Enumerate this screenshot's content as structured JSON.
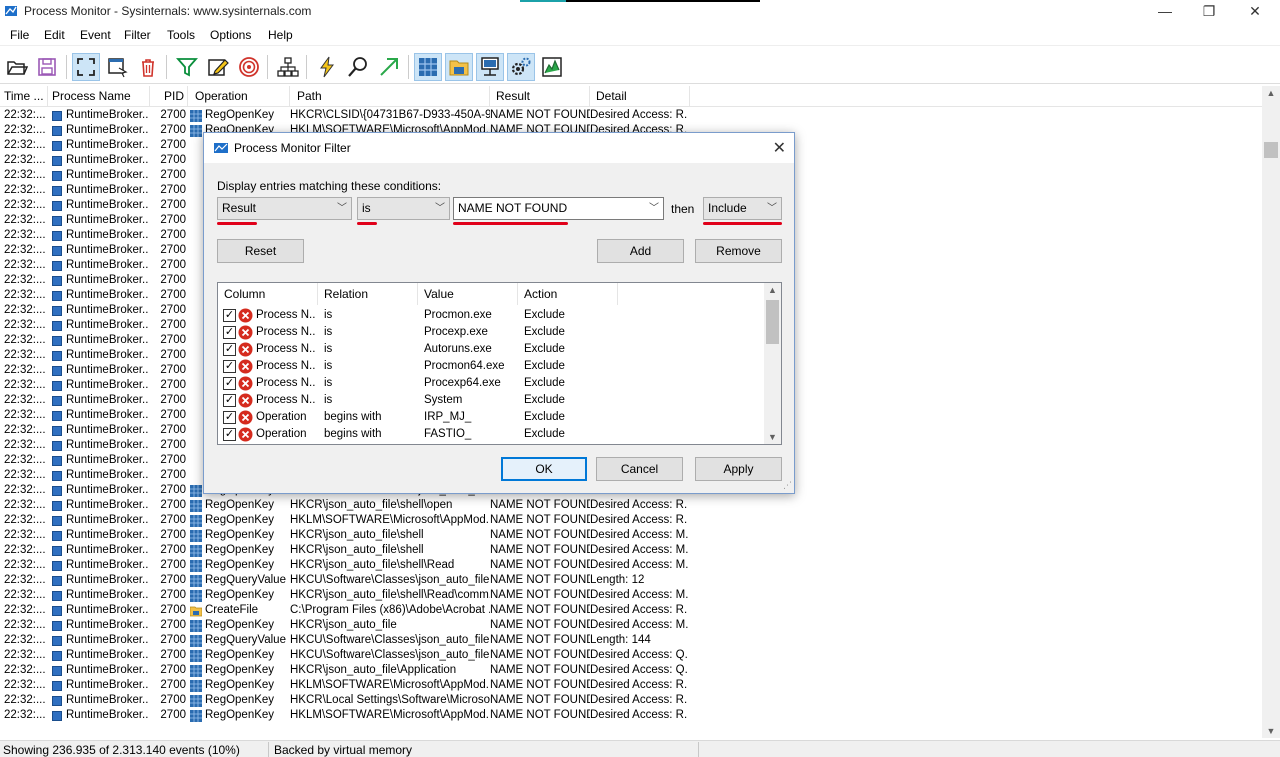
{
  "window": {
    "title": "Process Monitor - Sysinternals: www.sysinternals.com",
    "minimize_label": "—",
    "maximize_label": "❐",
    "close_label": "✕"
  },
  "menu": [
    "File",
    "Edit",
    "Event",
    "Filter",
    "Tools",
    "Options",
    "Help"
  ],
  "toolbar": {
    "icons": [
      "open-icon",
      "save-icon",
      "capture-icon",
      "autoscroll-icon",
      "clear-icon",
      "filter-icon",
      "highlight-icon",
      "target-icon",
      "process-tree-icon",
      "event-properties-icon",
      "find-icon",
      "jump-to-icon",
      "registry-activity-icon",
      "filesystem-activity-icon",
      "network-activity-icon",
      "process-activity-icon",
      "profiling-activity-icon"
    ]
  },
  "columns": [
    "Time ...",
    "Process Name",
    "PID",
    "Operation",
    "Path",
    "Result",
    "Detail"
  ],
  "events": [
    {
      "time": "22:32:...",
      "process": "RuntimeBroker....",
      "pid": "2700",
      "op": "RegOpenKey",
      "path": "HKCR\\CLSID\\{04731B67-D933-450A-9...",
      "result": "NAME NOT FOUND",
      "detail": "Desired Access: R..."
    },
    {
      "time": "22:32:...",
      "process": "RuntimeBroker....",
      "pid": "2700",
      "op": "RegOpenKey",
      "path": "HKLM\\SOFTWARE\\Microsoft\\AppMod...",
      "result": "NAME NOT FOUND",
      "detail": "Desired Access: R..."
    },
    {
      "time": "22:32:...",
      "process": "RuntimeBroker....",
      "pid": "2700",
      "op": "",
      "path": "",
      "result": "",
      "detail": ""
    },
    {
      "time": "22:32:...",
      "process": "RuntimeBroker....",
      "pid": "2700",
      "op": "",
      "path": "",
      "result": "",
      "detail": ""
    },
    {
      "time": "22:32:...",
      "process": "RuntimeBroker....",
      "pid": "2700",
      "op": "",
      "path": "",
      "result": "",
      "detail": ""
    },
    {
      "time": "22:32:...",
      "process": "RuntimeBroker....",
      "pid": "2700",
      "op": "",
      "path": "",
      "result": "",
      "detail": ""
    },
    {
      "time": "22:32:...",
      "process": "RuntimeBroker....",
      "pid": "2700",
      "op": "",
      "path": "",
      "result": "",
      "detail": ""
    },
    {
      "time": "22:32:...",
      "process": "RuntimeBroker....",
      "pid": "2700",
      "op": "",
      "path": "",
      "result": "",
      "detail": ""
    },
    {
      "time": "22:32:...",
      "process": "RuntimeBroker....",
      "pid": "2700",
      "op": "",
      "path": "",
      "result": "",
      "detail": ""
    },
    {
      "time": "22:32:...",
      "process": "RuntimeBroker....",
      "pid": "2700",
      "op": "",
      "path": "",
      "result": "",
      "detail": ""
    },
    {
      "time": "22:32:...",
      "process": "RuntimeBroker....",
      "pid": "2700",
      "op": "",
      "path": "",
      "result": "",
      "detail": ""
    },
    {
      "time": "22:32:...",
      "process": "RuntimeBroker....",
      "pid": "2700",
      "op": "",
      "path": "",
      "result": "",
      "detail": ""
    },
    {
      "time": "22:32:...",
      "process": "RuntimeBroker....",
      "pid": "2700",
      "op": "",
      "path": "",
      "result": "",
      "detail": ""
    },
    {
      "time": "22:32:...",
      "process": "RuntimeBroker....",
      "pid": "2700",
      "op": "",
      "path": "",
      "result": "",
      "detail": ""
    },
    {
      "time": "22:32:...",
      "process": "RuntimeBroker....",
      "pid": "2700",
      "op": "",
      "path": "",
      "result": "",
      "detail": ""
    },
    {
      "time": "22:32:...",
      "process": "RuntimeBroker....",
      "pid": "2700",
      "op": "",
      "path": "",
      "result": "",
      "detail": ""
    },
    {
      "time": "22:32:...",
      "process": "RuntimeBroker....",
      "pid": "2700",
      "op": "",
      "path": "",
      "result": "",
      "detail": ""
    },
    {
      "time": "22:32:...",
      "process": "RuntimeBroker....",
      "pid": "2700",
      "op": "",
      "path": "",
      "result": "",
      "detail": ""
    },
    {
      "time": "22:32:...",
      "process": "RuntimeBroker....",
      "pid": "2700",
      "op": "",
      "path": "",
      "result": "",
      "detail": ""
    },
    {
      "time": "22:32:...",
      "process": "RuntimeBroker....",
      "pid": "2700",
      "op": "",
      "path": "",
      "result": "",
      "detail": ""
    },
    {
      "time": "22:32:...",
      "process": "RuntimeBroker....",
      "pid": "2700",
      "op": "",
      "path": "",
      "result": "",
      "detail": ""
    },
    {
      "time": "22:32:...",
      "process": "RuntimeBroker....",
      "pid": "2700",
      "op": "",
      "path": "",
      "result": "",
      "detail": ""
    },
    {
      "time": "22:32:...",
      "process": "RuntimeBroker....",
      "pid": "2700",
      "op": "",
      "path": "",
      "result": "",
      "detail": ""
    },
    {
      "time": "22:32:...",
      "process": "RuntimeBroker....",
      "pid": "2700",
      "op": "",
      "path": "",
      "result": "",
      "detail": ""
    },
    {
      "time": "22:32:...",
      "process": "RuntimeBroker....",
      "pid": "2700",
      "op": "",
      "path": "",
      "result": "",
      "detail": ""
    },
    {
      "time": "22:32:...",
      "process": "RuntimeBroker....",
      "pid": "2700",
      "op": "RegOpenKey",
      "path": "HKCU\\Software\\Classes\\json_auto_file...",
      "result": "NAME NOT FOUND",
      "detail": "Desired Access: R..."
    },
    {
      "time": "22:32:...",
      "process": "RuntimeBroker....",
      "pid": "2700",
      "op": "RegOpenKey",
      "path": "HKCR\\json_auto_file\\shell\\open",
      "result": "NAME NOT FOUND",
      "detail": "Desired Access: R..."
    },
    {
      "time": "22:32:...",
      "process": "RuntimeBroker....",
      "pid": "2700",
      "op": "RegOpenKey",
      "path": "HKLM\\SOFTWARE\\Microsoft\\AppMod...",
      "result": "NAME NOT FOUND",
      "detail": "Desired Access: R..."
    },
    {
      "time": "22:32:...",
      "process": "RuntimeBroker....",
      "pid": "2700",
      "op": "RegOpenKey",
      "path": "HKCR\\json_auto_file\\shell",
      "result": "NAME NOT FOUND",
      "detail": "Desired Access: M..."
    },
    {
      "time": "22:32:...",
      "process": "RuntimeBroker....",
      "pid": "2700",
      "op": "RegOpenKey",
      "path": "HKCR\\json_auto_file\\shell",
      "result": "NAME NOT FOUND",
      "detail": "Desired Access: M..."
    },
    {
      "time": "22:32:...",
      "process": "RuntimeBroker....",
      "pid": "2700",
      "op": "RegOpenKey",
      "path": "HKCR\\json_auto_file\\shell\\Read",
      "result": "NAME NOT FOUND",
      "detail": "Desired Access: M..."
    },
    {
      "time": "22:32:...",
      "process": "RuntimeBroker....",
      "pid": "2700",
      "op": "RegQueryValue",
      "path": "HKCU\\Software\\Classes\\json_auto_file...",
      "result": "NAME NOT FOUND",
      "detail": "Length: 12"
    },
    {
      "time": "22:32:...",
      "process": "RuntimeBroker....",
      "pid": "2700",
      "op": "RegOpenKey",
      "path": "HKCR\\json_auto_file\\shell\\Read\\comm...",
      "result": "NAME NOT FOUND",
      "detail": "Desired Access: M..."
    },
    {
      "time": "22:32:...",
      "process": "RuntimeBroker....",
      "pid": "2700",
      "op": "CreateFile",
      "path": "C:\\Program Files (x86)\\Adobe\\Acrobat ...",
      "result": "NAME NOT FOUND",
      "detail": "Desired Access: R..."
    },
    {
      "time": "22:32:...",
      "process": "RuntimeBroker....",
      "pid": "2700",
      "op": "RegOpenKey",
      "path": "HKCR\\json_auto_file",
      "result": "NAME NOT FOUND",
      "detail": "Desired Access: M..."
    },
    {
      "time": "22:32:...",
      "process": "RuntimeBroker....",
      "pid": "2700",
      "op": "RegQueryValue",
      "path": "HKCU\\Software\\Classes\\json_auto_file...",
      "result": "NAME NOT FOUND",
      "detail": "Length: 144"
    },
    {
      "time": "22:32:...",
      "process": "RuntimeBroker....",
      "pid": "2700",
      "op": "RegOpenKey",
      "path": "HKCU\\Software\\Classes\\json_auto_file...",
      "result": "NAME NOT FOUND",
      "detail": "Desired Access: Q..."
    },
    {
      "time": "22:32:...",
      "process": "RuntimeBroker....",
      "pid": "2700",
      "op": "RegOpenKey",
      "path": "HKCR\\json_auto_file\\Application",
      "result": "NAME NOT FOUND",
      "detail": "Desired Access: Q..."
    },
    {
      "time": "22:32:...",
      "process": "RuntimeBroker....",
      "pid": "2700",
      "op": "RegOpenKey",
      "path": "HKLM\\SOFTWARE\\Microsoft\\AppMod...",
      "result": "NAME NOT FOUND",
      "detail": "Desired Access: R..."
    },
    {
      "time": "22:32:...",
      "process": "RuntimeBroker....",
      "pid": "2700",
      "op": "RegOpenKey",
      "path": "HKCR\\Local Settings\\Software\\Microso...",
      "result": "NAME NOT FOUND",
      "detail": "Desired Access: R..."
    },
    {
      "time": "22:32:...",
      "process": "RuntimeBroker....",
      "pid": "2700",
      "op": "RegOpenKey",
      "path": "HKLM\\SOFTWARE\\Microsoft\\AppMod...",
      "result": "NAME NOT FOUND",
      "detail": "Desired Access: R..."
    }
  ],
  "status": {
    "showing": "Showing 236.935 of 2.313.140 events (10%)",
    "backing": "Backed by virtual memory"
  },
  "filter_dialog": {
    "title": "Process Monitor Filter",
    "prompt": "Display entries matching these conditions:",
    "column_value": "Result",
    "relation_value": "is",
    "value_value": "NAME NOT FOUND",
    "then_label": "then",
    "action_value": "Include",
    "reset_label": "Reset",
    "add_label": "Add",
    "remove_label": "Remove",
    "list_headers": [
      "Column",
      "Relation",
      "Value",
      "Action"
    ],
    "rules": [
      {
        "column": "Process N...",
        "relation": "is",
        "value": "Procmon.exe",
        "action": "Exclude"
      },
      {
        "column": "Process N...",
        "relation": "is",
        "value": "Procexp.exe",
        "action": "Exclude"
      },
      {
        "column": "Process N...",
        "relation": "is",
        "value": "Autoruns.exe",
        "action": "Exclude"
      },
      {
        "column": "Process N...",
        "relation": "is",
        "value": "Procmon64.exe",
        "action": "Exclude"
      },
      {
        "column": "Process N...",
        "relation": "is",
        "value": "Procexp64.exe",
        "action": "Exclude"
      },
      {
        "column": "Process N...",
        "relation": "is",
        "value": "System",
        "action": "Exclude"
      },
      {
        "column": "Operation",
        "relation": "begins with",
        "value": "IRP_MJ_",
        "action": "Exclude"
      },
      {
        "column": "Operation",
        "relation": "begins with",
        "value": "FASTIO_",
        "action": "Exclude"
      }
    ],
    "ok_label": "OK",
    "cancel_label": "Cancel",
    "apply_label": "Apply",
    "checkmark": "✓"
  },
  "colors": {
    "highlight_underline": "#e0001a",
    "default_button_border": "#0078d7",
    "toolbar_active": "#cde5f7"
  }
}
